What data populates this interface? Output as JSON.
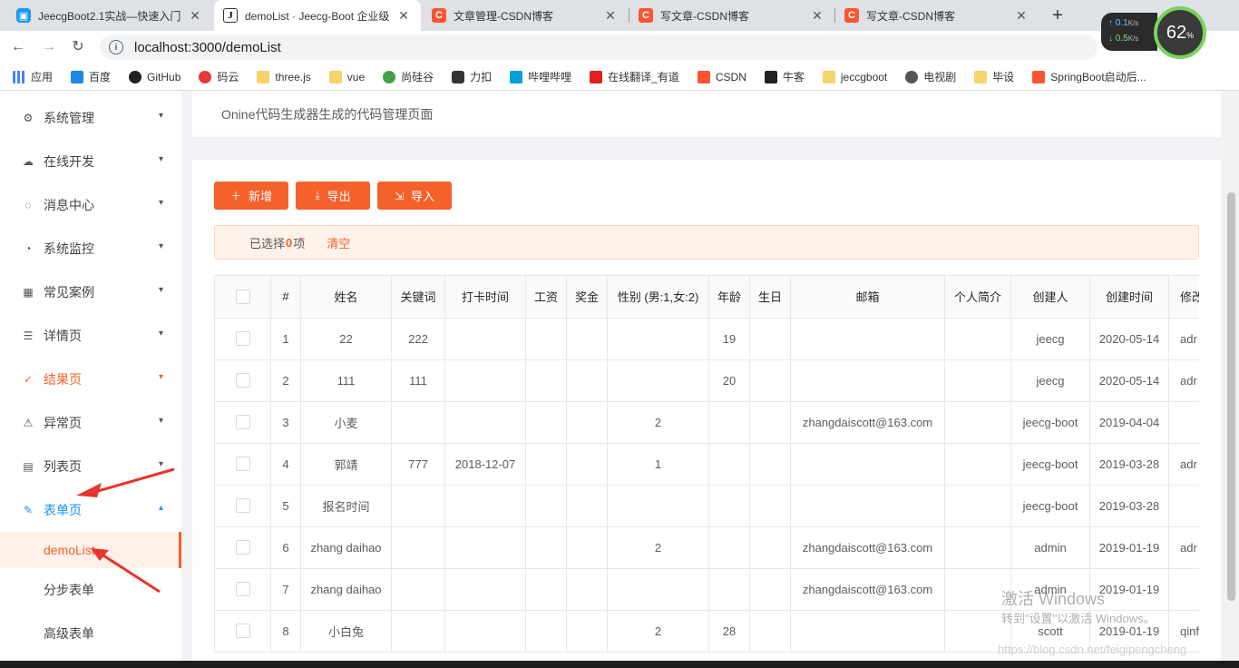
{
  "browser": {
    "tabs": [
      {
        "title": "JeecgBoot2.1实战—快速入门",
        "favicon": "jeecg",
        "active": false
      },
      {
        "title": "demoList · Jeecg-Boot 企业级",
        "favicon": "j",
        "active": true
      },
      {
        "title": "文章管理-CSDN博客",
        "favicon": "csdn",
        "active": false
      },
      {
        "title": "写文章-CSDN博客",
        "favicon": "csdn",
        "active": false
      },
      {
        "title": "写文章-CSDN博客",
        "favicon": "csdn",
        "active": false
      }
    ],
    "url": "localhost:3000/demoList",
    "network": {
      "up": "0.1",
      "down": "0.5",
      "unit": "K/s"
    },
    "cpu": {
      "value": "62",
      "unit": "%"
    },
    "bookmarks": [
      "应用",
      "百度",
      "GitHub",
      "码云",
      "three.js",
      "vue",
      "尚硅谷",
      "力扣",
      "哔哩哔哩",
      "在线翻译_有道",
      "CSDN",
      "牛客",
      "jeccgboot",
      "电视剧",
      "毕设",
      "SpringBoot启动后..."
    ]
  },
  "sidebar": {
    "items": [
      {
        "label": "系统管理",
        "icon": "gear-icon"
      },
      {
        "label": "在线开发",
        "icon": "cloud-icon"
      },
      {
        "label": "消息中心",
        "icon": "message-icon"
      },
      {
        "label": "系统监控",
        "icon": "dashboard-icon"
      },
      {
        "label": "常见案例",
        "icon": "appstore-icon"
      },
      {
        "label": "详情页",
        "icon": "profile-icon"
      },
      {
        "label": "结果页",
        "icon": "check-circle-icon"
      },
      {
        "label": "异常页",
        "icon": "warning-icon"
      },
      {
        "label": "列表页",
        "icon": "table-icon"
      },
      {
        "label": "表单页",
        "icon": "form-icon"
      }
    ],
    "subitems": [
      "demoList",
      "分步表单",
      "高级表单"
    ]
  },
  "page": {
    "description": "Onine代码生成器生成的代码管理页面"
  },
  "toolbar": {
    "add_label": "新增",
    "export_label": "导出",
    "import_label": "导入"
  },
  "selection": {
    "prefix": "已选择",
    "count": "0",
    "suffix": "项",
    "clear_label": "清空"
  },
  "table": {
    "columns": [
      "#",
      "姓名",
      "关键词",
      "打卡时间",
      "工资",
      "奖金",
      "性别 (男:1,女:2)",
      "年龄",
      "生日",
      "邮箱",
      "个人简介",
      "创建人",
      "创建时间",
      "修改"
    ],
    "rows": [
      [
        "1",
        "22",
        "222",
        "",
        "",
        "",
        "",
        "19",
        "",
        "",
        "",
        "jeecg",
        "2020-05-14",
        "adr"
      ],
      [
        "2",
        "111",
        "111",
        "",
        "",
        "",
        "",
        "20",
        "",
        "",
        "",
        "jeecg",
        "2020-05-14",
        "adr"
      ],
      [
        "3",
        "小麦",
        "",
        "",
        "",
        "",
        "2",
        "",
        "",
        "zhangdaiscott@163.com",
        "",
        "jeecg-boot",
        "2019-04-04",
        ""
      ],
      [
        "4",
        "郭靖",
        "777",
        "2018-12-07",
        "",
        "",
        "1",
        "",
        "",
        "",
        "",
        "jeecg-boot",
        "2019-03-28",
        "adr"
      ],
      [
        "5",
        "报名时间",
        "",
        "",
        "",
        "",
        "",
        "",
        "",
        "",
        "",
        "jeecg-boot",
        "2019-03-28",
        ""
      ],
      [
        "6",
        "zhang daihao",
        "",
        "",
        "",
        "",
        "2",
        "",
        "",
        "zhangdaiscott@163.com",
        "",
        "admin",
        "2019-01-19",
        "adr"
      ],
      [
        "7",
        "zhang daihao",
        "",
        "",
        "",
        "",
        "",
        "",
        "",
        "zhangdaiscott@163.com",
        "",
        "admin",
        "2019-01-19",
        ""
      ],
      [
        "8",
        "小白兔",
        "",
        "",
        "",
        "",
        "2",
        "28",
        "",
        "",
        "",
        "scott",
        "2019-01-19",
        "qinf"
      ]
    ]
  },
  "watermark": {
    "line1": "激活 Windows",
    "line2": "转到\"设置\"以激活 Windows。",
    "csdn": "https://blog.csdn.net/feigipengcheng"
  },
  "colors": {
    "accent": "#f5612a",
    "link_blue": "#1890ff"
  }
}
